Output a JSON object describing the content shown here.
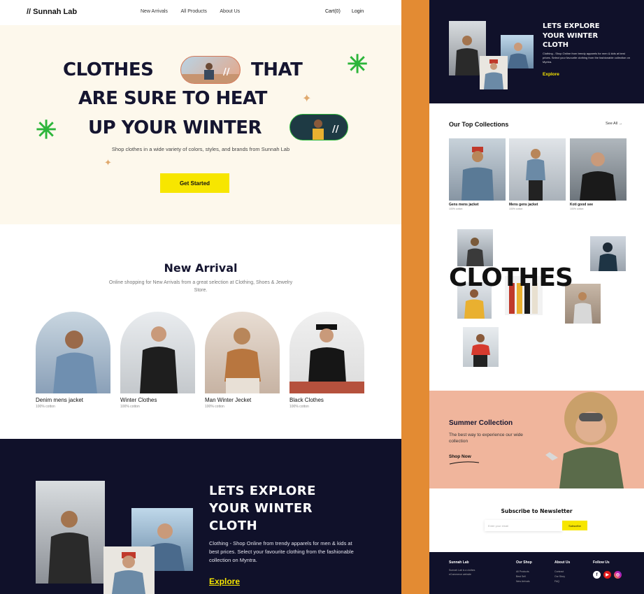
{
  "nav": {
    "logo": "// Sunnah Lab",
    "links": [
      "New Arrivals",
      "All Products",
      "About Us"
    ],
    "cart": "Cart(0)",
    "login": "Login"
  },
  "hero": {
    "line1a": "CLOTHES",
    "line1b": "THAT",
    "line2": "ARE SURE TO HEAT",
    "line3": "UP YOUR WINTER",
    "subtitle": "Shop clothes in a wide variety of colors, styles, and brands from Sunnah Lab",
    "cta": "Get Started"
  },
  "new_arrival": {
    "title": "New Arrival",
    "subtitle": "Online shopping for New Arrivals from a great selection at Clothing, Shoes & Jewelry Store.",
    "products": [
      {
        "name": "Denim mens jacket",
        "sub": "100% cotton"
      },
      {
        "name": "Winter Clothes",
        "sub": "100% cotton"
      },
      {
        "name": "Man Winter Jecket",
        "sub": "100% cotton"
      },
      {
        "name": "Black Clothes",
        "sub": "100% cotton"
      }
    ]
  },
  "explore": {
    "title_lines": [
      "LETS EXPLORE",
      "YOUR WINTER",
      "CLOTH"
    ],
    "body": "Clothing - Shop Online from trendy apparels for men & kids at best prices. Select your favourite clothing from the fashionable collection on Myntra.",
    "link": "Explore"
  },
  "mobile": {
    "explore": {
      "title_lines": [
        "LETS EXPLORE",
        "YOUR WINTER",
        "CLOTH"
      ],
      "body": "Clothing - Shop Online from trendy apparels for men & kids at best prices. Select your favourite clothing from the fashionable collection on Myntra.",
      "link": "Explore"
    },
    "top_collections": {
      "title": "Our Top Collections",
      "see_all": "See All →",
      "items": [
        {
          "name": "Gens mens jacket",
          "sub": "100% cotton"
        },
        {
          "name": "Mens gens jacket",
          "sub": "100% cotton"
        },
        {
          "name": "Koti good see",
          "sub": "100% cotton"
        }
      ]
    },
    "clothes_word": "CLOTHES",
    "summer": {
      "title": "Summer Collection",
      "subtitle": "The best way to experience our wide collection",
      "link": "Shop Now"
    },
    "newsletter": {
      "title": "Subscribe to Newsletter",
      "placeholder": "Enter your email",
      "button": "Subscribe"
    },
    "footer": {
      "brand": "Sunnah Lab",
      "brand_text": "Sunnah Lab is a clothes eCommerce website",
      "cols": [
        {
          "title": "Our Shop",
          "items": [
            "All Products",
            "Best Sell",
            "New Arrivals"
          ]
        },
        {
          "title": "About Us",
          "items": [
            "Contract",
            "Our Story",
            "FAQ"
          ]
        }
      ],
      "follow": "Follow Us",
      "social": [
        "f-icon",
        "youtube-icon",
        "instagram-icon"
      ]
    }
  },
  "colors": {
    "accent_yellow": "#f7e600",
    "dark_navy": "#10112a",
    "hero_bg": "#fdf8ec",
    "spark_green": "#2cb53a",
    "frame_orange": "#e38b33",
    "summer_bg": "#f0b59c"
  }
}
